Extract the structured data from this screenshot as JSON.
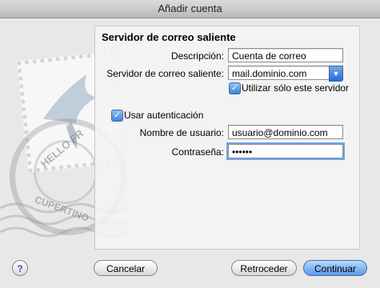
{
  "window": {
    "title": "Añadir cuenta"
  },
  "background": {
    "postmark_text_top": "HELLO FR",
    "postmark_text_bottom": "CUPERTINO"
  },
  "section": {
    "title": "Servidor de correo saliente"
  },
  "form": {
    "description_label": "Descripción:",
    "description_value": "Cuenta de correo",
    "server_label": "Servidor de correo saliente:",
    "server_value": "mail.dominio.com",
    "only_this_server_label": "Utilizar sólo este servidor",
    "only_this_server_checked": true,
    "use_auth_label": "Usar autenticación",
    "use_auth_checked": true,
    "username_label": "Nombre de usuario:",
    "username_value": "usuario@dominio.com",
    "password_label": "Contraseña:",
    "password_value": "••••••"
  },
  "buttons": {
    "help": "?",
    "cancel": "Cancelar",
    "back": "Retroceder",
    "continue": "Continuar"
  }
}
